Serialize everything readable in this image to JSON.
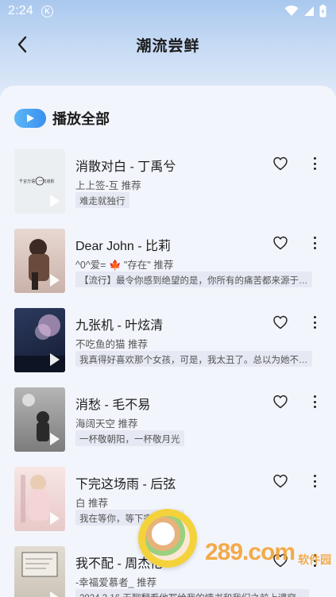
{
  "status": {
    "time": "2:24",
    "k_badge": "K"
  },
  "header": {
    "title": "潮流尝鲜"
  },
  "playall": {
    "label": "播放全部"
  },
  "songs": [
    {
      "title": "消散对白 - 丁禹兮",
      "sub": "上上签-互 推荐",
      "tag": "难走就独行",
      "cover": {
        "bg": "#eceff2",
        "accent": "#333333"
      }
    },
    {
      "title": "Dear John - 比莉",
      "sub": "^0^爱= 🍁 \"存在\" 推荐",
      "tag": "【流行】最令你感到绝望的是，你所有的痛苦都来源于…",
      "cover": {
        "bg": "#d8c8c2",
        "accent": "#3d2a24"
      }
    },
    {
      "title": "九张机 - 叶炫清",
      "sub": "不吃鱼的猫 推荐",
      "tag": "我真得好喜欢那个女孩，可是，我太丑了。总以为她不…",
      "cover": {
        "bg": "#1a2540",
        "accent": "#c8a6cf"
      }
    },
    {
      "title": "消愁 - 毛不易",
      "sub": "海阔天空 推荐",
      "tag": "一杯敬朝阳，一杯敬月光",
      "cover": {
        "bg": "#9a9a9a",
        "accent": "#2a2a2a"
      }
    },
    {
      "title": "下完这场雨 - 后弦",
      "sub": "白 推荐",
      "tag": "我在等你，等下完这场雨",
      "cover": {
        "bg": "#f0d8d8",
        "accent": "#c9a0a4"
      }
    },
    {
      "title": "我不配 - 周杰伦",
      "sub": "-幸福爱慕者_ 推荐",
      "tag": "2024.3.16 无聊翻看他写给我的情书和我们之前上课穿…",
      "cover": {
        "bg": "#d6cfc4",
        "accent": "#333333"
      }
    }
  ],
  "watermark": {
    "text": "289.com",
    "sub": "软件园"
  },
  "colors": {
    "accent": "#3a8ff0",
    "panel": "#f3f5fc",
    "tag_bg": "#e6e9f3"
  }
}
